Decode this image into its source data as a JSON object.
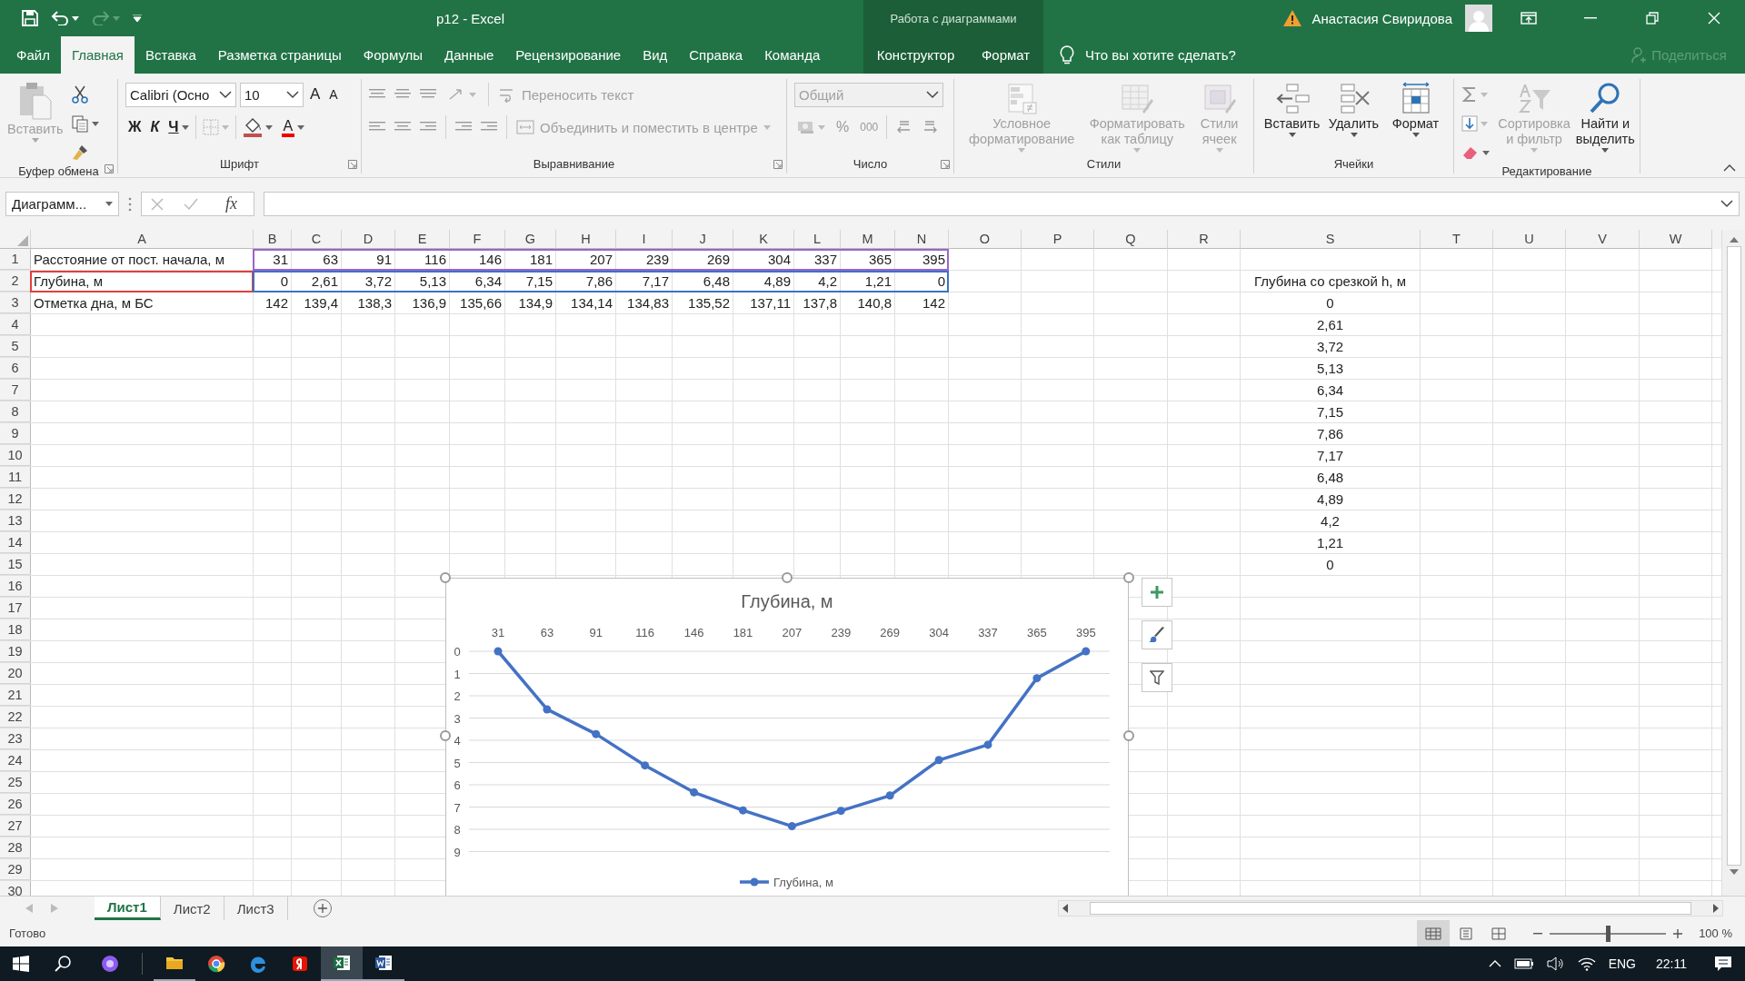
{
  "title_bar": {
    "title": "p12  -  Excel",
    "context_label": "Работа с диаграммами",
    "user": "Анастасия Свиридова"
  },
  "ribbon_tabs": [
    {
      "label": "Файл",
      "selected": false,
      "kind": "normal"
    },
    {
      "label": "Главная",
      "selected": true,
      "kind": "normal"
    },
    {
      "label": "Вставка",
      "selected": false,
      "kind": "normal"
    },
    {
      "label": "Разметка страницы",
      "selected": false,
      "kind": "normal"
    },
    {
      "label": "Формулы",
      "selected": false,
      "kind": "normal"
    },
    {
      "label": "Данные",
      "selected": false,
      "kind": "normal"
    },
    {
      "label": "Рецензирование",
      "selected": false,
      "kind": "normal"
    },
    {
      "label": "Вид",
      "selected": false,
      "kind": "normal"
    },
    {
      "label": "Справка",
      "selected": false,
      "kind": "normal"
    },
    {
      "label": "Команда",
      "selected": false,
      "kind": "normal"
    },
    {
      "label": "Конструктор",
      "selected": false,
      "kind": "context"
    },
    {
      "label": "Формат",
      "selected": false,
      "kind": "context"
    }
  ],
  "tell_me": {
    "placeholder": "Что вы хотите сделать?"
  },
  "share": {
    "label": "Поделиться",
    "disabled": true
  },
  "ribbon_groups": [
    {
      "kind": "clipboard",
      "label": "Буфер обмена",
      "paste": {
        "label": "Вставить",
        "disabled": true
      }
    },
    {
      "kind": "font",
      "label": "Шрифт",
      "font_name": "Calibri (Осно",
      "font_size": "10",
      "grow": "A",
      "shrink": "A",
      "bold": "Ж",
      "italic": "К",
      "underline": "Ч",
      "font_color": "A"
    },
    {
      "kind": "alignment",
      "label": "Выравнивание",
      "wrap": {
        "label": "Переносить текст",
        "disabled": true
      },
      "merge": {
        "label": "Объединить и поместить в центре",
        "disabled": true
      }
    },
    {
      "kind": "number",
      "label": "Число",
      "format": {
        "value": "Общий",
        "disabled": true
      },
      "percent": "%",
      "thousands": "000"
    },
    {
      "kind": "buttons",
      "label": "Стили",
      "buttons": [
        {
          "label": "Условное форматирование",
          "disabled": true
        },
        {
          "label": "Форматировать как таблицу",
          "disabled": true
        },
        {
          "label": "Стили ячеек",
          "disabled": true
        }
      ]
    },
    {
      "kind": "buttons",
      "label": "Ячейки",
      "buttons": [
        {
          "label": "Вставить",
          "disabled": false
        },
        {
          "label": "Удалить",
          "disabled": false
        },
        {
          "label": "Формат",
          "disabled": false
        }
      ]
    },
    {
      "kind": "editing",
      "label": "Редактирование",
      "buttons": [
        {
          "label": "Сортировка и фильтр",
          "disabled": true
        },
        {
          "label": "Найти и выделить",
          "disabled": false
        }
      ]
    }
  ],
  "formula_bar": {
    "name_box": "Диаграмм...",
    "fx": "fx"
  },
  "grid": {
    "columns": [
      "A",
      "B",
      "C",
      "D",
      "E",
      "F",
      "G",
      "H",
      "I",
      "J",
      "K",
      "L",
      "M",
      "N",
      "O",
      "P",
      "Q",
      "R",
      "S",
      "T",
      "U",
      "V",
      "W"
    ],
    "rows": [
      {
        "number": "1",
        "cells": [
          "Расстояние от пост. начала, м",
          "31",
          "63",
          "91",
          "116",
          "146",
          "181",
          "207",
          "239",
          "269",
          "304",
          "337",
          "365",
          "395"
        ],
        "kind": "categories"
      },
      {
        "number": "2",
        "cells": [
          "Глубина, м",
          "0",
          "2,61",
          "3,72",
          "5,13",
          "6,34",
          "7,15",
          "7,86",
          "7,17",
          "6,48",
          "4,89",
          "4,2",
          "1,21",
          "0"
        ],
        "kind": "values",
        "s_cell": "Глубина со срезкой h, м"
      },
      {
        "number": "3",
        "cells": [
          "Отметка дна, м БС",
          "142",
          "139,4",
          "138,3",
          "136,9",
          "135,66",
          "134,9",
          "134,14",
          "134,83",
          "135,52",
          "137,11",
          "137,8",
          "140,8",
          "142"
        ],
        "s_cell": "0"
      },
      {
        "number": "4",
        "s_cell": "2,61"
      },
      {
        "number": "5",
        "s_cell": "3,72"
      },
      {
        "number": "6",
        "s_cell": "5,13"
      },
      {
        "number": "7",
        "s_cell": "6,34"
      },
      {
        "number": "8",
        "s_cell": "7,15"
      },
      {
        "number": "9",
        "s_cell": "7,86"
      },
      {
        "number": "10",
        "s_cell": "7,17"
      },
      {
        "number": "11",
        "s_cell": "6,48"
      },
      {
        "number": "12",
        "s_cell": "4,89"
      },
      {
        "number": "13",
        "s_cell": "4,2"
      },
      {
        "number": "14",
        "s_cell": "1,21"
      },
      {
        "number": "15",
        "s_cell": "0"
      },
      {
        "number": "16"
      },
      {
        "number": "17"
      },
      {
        "number": "18"
      },
      {
        "number": "19"
      },
      {
        "number": "20"
      },
      {
        "number": "21"
      },
      {
        "number": "22"
      },
      {
        "number": "23"
      },
      {
        "number": "24"
      },
      {
        "number": "25"
      },
      {
        "number": "26"
      },
      {
        "number": "27"
      },
      {
        "number": "28"
      },
      {
        "number": "29"
      },
      {
        "number": "30"
      }
    ]
  },
  "chart": {
    "chart_data": {
      "type": "line",
      "title": "Глубина, м",
      "categories": [
        "31",
        "63",
        "91",
        "116",
        "146",
        "181",
        "207",
        "239",
        "269",
        "304",
        "337",
        "365",
        "395"
      ],
      "series": [
        {
          "name": "Глубина, м",
          "color": "#4472c4",
          "marker": "circle",
          "values": [
            0,
            2.61,
            3.72,
            5.13,
            6.34,
            7.15,
            7.86,
            7.17,
            6.48,
            4.89,
            4.2,
            1.21,
            0
          ]
        }
      ],
      "grid": true,
      "ylim": [
        9,
        0
      ],
      "yticks": [
        0,
        1,
        2,
        3,
        4,
        5,
        6,
        7,
        8,
        9
      ]
    }
  },
  "sheet_tabs": [
    {
      "label": "Лист1",
      "selected": true
    },
    {
      "label": "Лист2",
      "selected": false
    },
    {
      "label": "Лист3",
      "selected": false
    }
  ],
  "status_bar": {
    "text": "Готово",
    "views": [
      {
        "kind": "normal",
        "selected": true
      },
      {
        "kind": "page_layout",
        "selected": false
      },
      {
        "kind": "page_break",
        "selected": false
      }
    ],
    "zoom_slider": {
      "level": 0.5
    },
    "zoom": "100 %"
  },
  "taskbar": {
    "apps": [
      {
        "kind": "explorer",
        "running": true,
        "selected": false
      },
      {
        "kind": "chrome",
        "running": false,
        "selected": false
      },
      {
        "kind": "edge",
        "running": false,
        "selected": false
      },
      {
        "kind": "yandex",
        "running": false,
        "selected": false
      },
      {
        "kind": "excel",
        "running": true,
        "selected": true
      },
      {
        "kind": "word",
        "running": true,
        "selected": false
      }
    ],
    "language": "ENG",
    "time": "22:11"
  }
}
